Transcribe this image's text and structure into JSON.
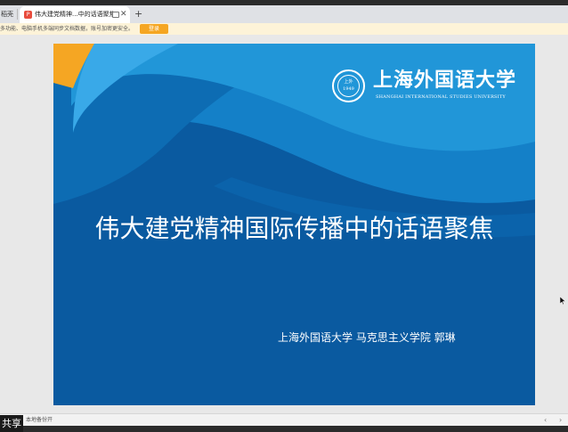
{
  "browser": {
    "prev_tab_label": "稻壳",
    "active_tab": {
      "title": "伟大建党精神...中的话语聚焦",
      "favicon_glyph": "P",
      "favicon_color": "#e84c3d"
    },
    "close_glyph": "✕",
    "new_tab_glyph": "+"
  },
  "notice": {
    "text": "多功能、电脑手机多端同步文档数据，账号加密更安全。",
    "button_label": "登录",
    "button_color": "#f5a623"
  },
  "slide": {
    "background_color": "#0a5aa0",
    "accent_color": "#f5a623",
    "university_cn": "上海外国语大学",
    "university_en": "SHANGHAI INTERNATIONAL STUDIES UNIVERSITY",
    "seal_line1": "上外",
    "seal_line2": "1949",
    "title": "伟大建党精神国际传播中的话语聚焦",
    "author": "上海外国语大学  马克思主义学院          郭琳"
  },
  "bottom": {
    "share_label": "共享",
    "status_text": "本地备份开",
    "prev_glyph": "‹",
    "next_glyph": "›"
  }
}
